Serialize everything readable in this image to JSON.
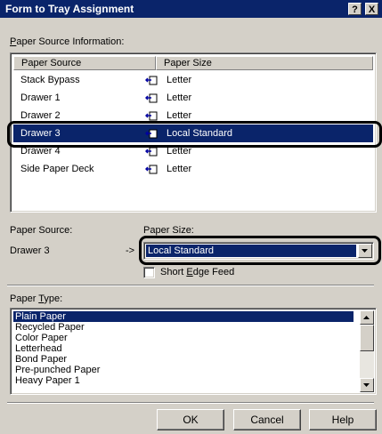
{
  "window": {
    "title": "Form to Tray Assignment",
    "help_btn": "?",
    "close_btn": "X"
  },
  "paper_source_info": {
    "label_accel": "P",
    "label_rest": "aper Source Information:",
    "columns": [
      "Paper Source",
      "Paper Size"
    ],
    "rows": [
      {
        "source": "Stack Bypass",
        "size": "Letter",
        "icon": "tray-arrow-icon"
      },
      {
        "source": "Drawer 1",
        "size": "Letter",
        "icon": "tray-arrow-icon"
      },
      {
        "source": "Drawer 2",
        "size": "Letter",
        "icon": "tray-arrow-icon"
      },
      {
        "source": "Drawer 3",
        "size": "Local Standard",
        "icon": "tray-arrow-icon"
      },
      {
        "source": "Drawer 4",
        "size": "Letter",
        "icon": "tray-arrow-icon"
      },
      {
        "source": "Side Paper Deck",
        "size": "Letter",
        "icon": "tray-arrow-icon"
      }
    ],
    "selected_index": 3
  },
  "assignment": {
    "source_label": "Paper Source:",
    "source_value": "Drawer 3",
    "arrow": "->",
    "size_label": "Paper Size:",
    "size_selected": "Local Standard",
    "short_edge_pre": "Short ",
    "short_edge_accel": "E",
    "short_edge_post": "dge Feed",
    "short_edge_checked": false
  },
  "paper_type": {
    "label_pre": "Paper ",
    "label_accel": "T",
    "label_post": "ype:",
    "items": [
      "Plain Paper",
      "Recycled Paper",
      "Color Paper",
      "Letterhead",
      "Bond Paper",
      "Pre-punched Paper",
      "Heavy Paper 1"
    ],
    "selected_index": 0
  },
  "buttons": {
    "ok": "OK",
    "cancel": "Cancel",
    "help": "Help"
  },
  "colors": {
    "selection": "#0a246a",
    "face": "#d4d0c8"
  }
}
